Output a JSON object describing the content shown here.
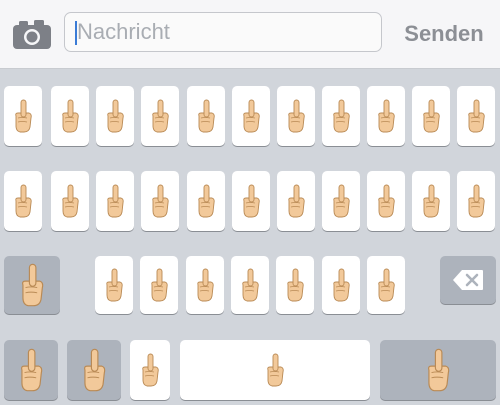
{
  "compose": {
    "camera_icon": "camera-icon",
    "placeholder": "Nachricht",
    "value": "",
    "send_label": "Senden"
  },
  "keyboard": {
    "key_glyph": "raised-finger-hand",
    "backspace_icon": "backspace-icon",
    "colors": {
      "background": "#d1d5db",
      "key": "#ffffff",
      "special_key": "#adb3bc",
      "hand_fill": "#f2c99a",
      "hand_stroke": "#b98a55"
    }
  }
}
